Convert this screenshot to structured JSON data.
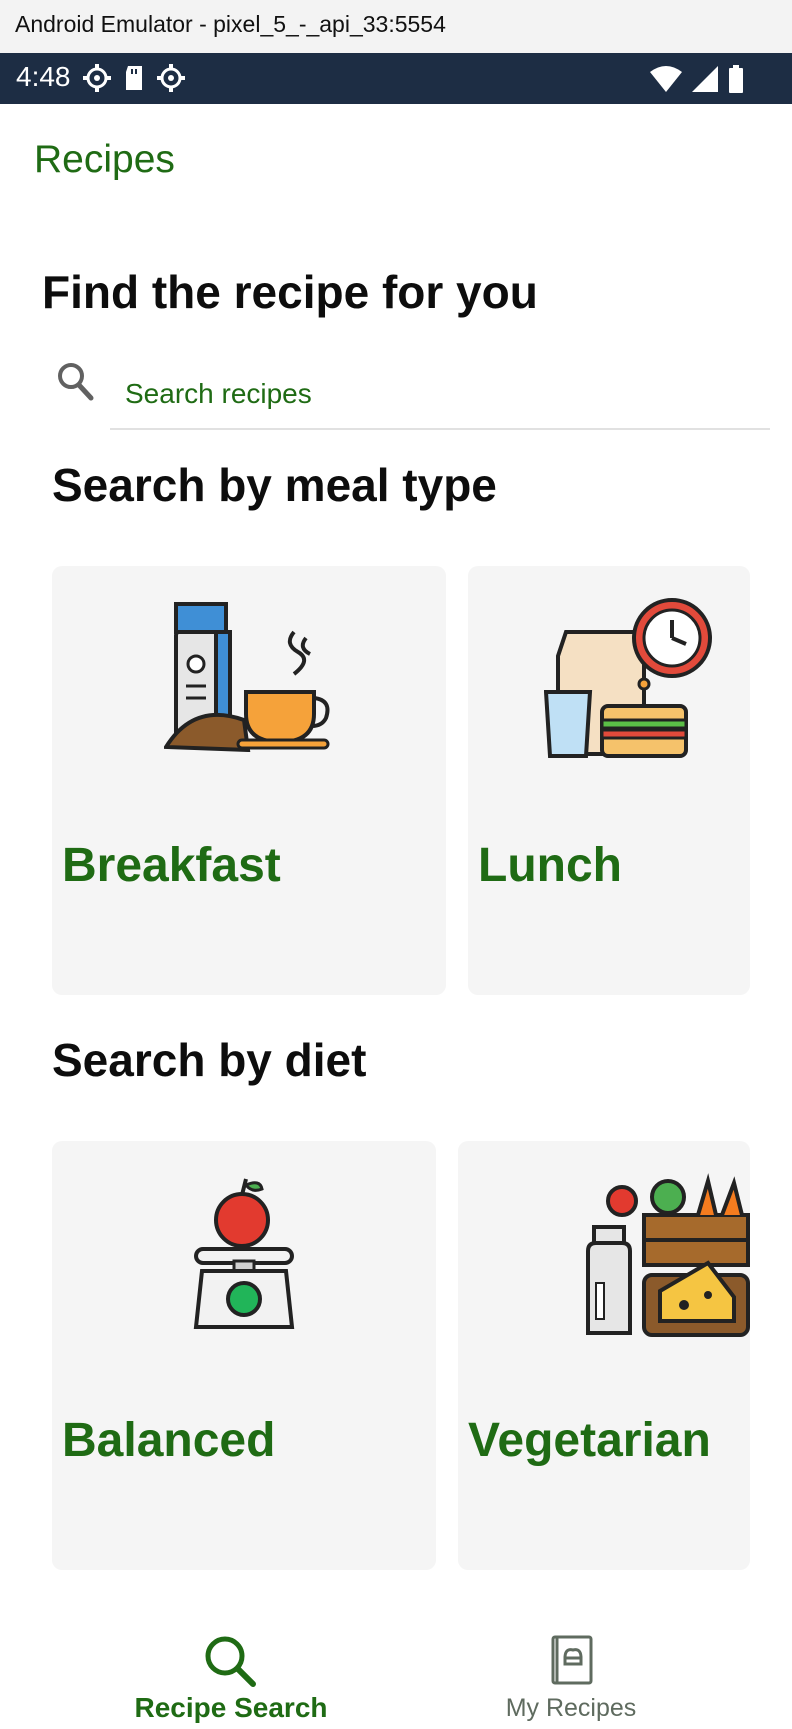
{
  "window": {
    "title": "Android Emulator - pixel_5_-_api_33:5554"
  },
  "status_bar": {
    "time": "4:48",
    "icons": [
      "settings-icon",
      "sd-card-icon",
      "settings-icon",
      "wifi-icon",
      "signal-icon",
      "battery-icon"
    ]
  },
  "app_bar": {
    "title": "Recipes"
  },
  "hero": {
    "title": "Find the recipe for you"
  },
  "search": {
    "placeholder": "Search recipes",
    "value": ""
  },
  "meal_section": {
    "title": "Search by meal type",
    "cards": [
      {
        "label": "Breakfast",
        "icon": "breakfast-icon"
      },
      {
        "label": "Lunch",
        "icon": "lunch-icon"
      }
    ]
  },
  "diet_section": {
    "title": "Search by diet",
    "cards": [
      {
        "label": "Balanced",
        "icon": "balanced-icon"
      },
      {
        "label": "Vegetarian",
        "icon": "vegetarian-icon"
      }
    ]
  },
  "bottom_nav": {
    "items": [
      {
        "label": "Recipe Search",
        "icon": "search-icon",
        "active": true
      },
      {
        "label": "My Recipes",
        "icon": "recipe-book-icon",
        "active": false
      }
    ]
  },
  "colors": {
    "accent": "#1f6b14",
    "status_bar": "#1d2d44",
    "card_bg": "#f5f5f5"
  }
}
